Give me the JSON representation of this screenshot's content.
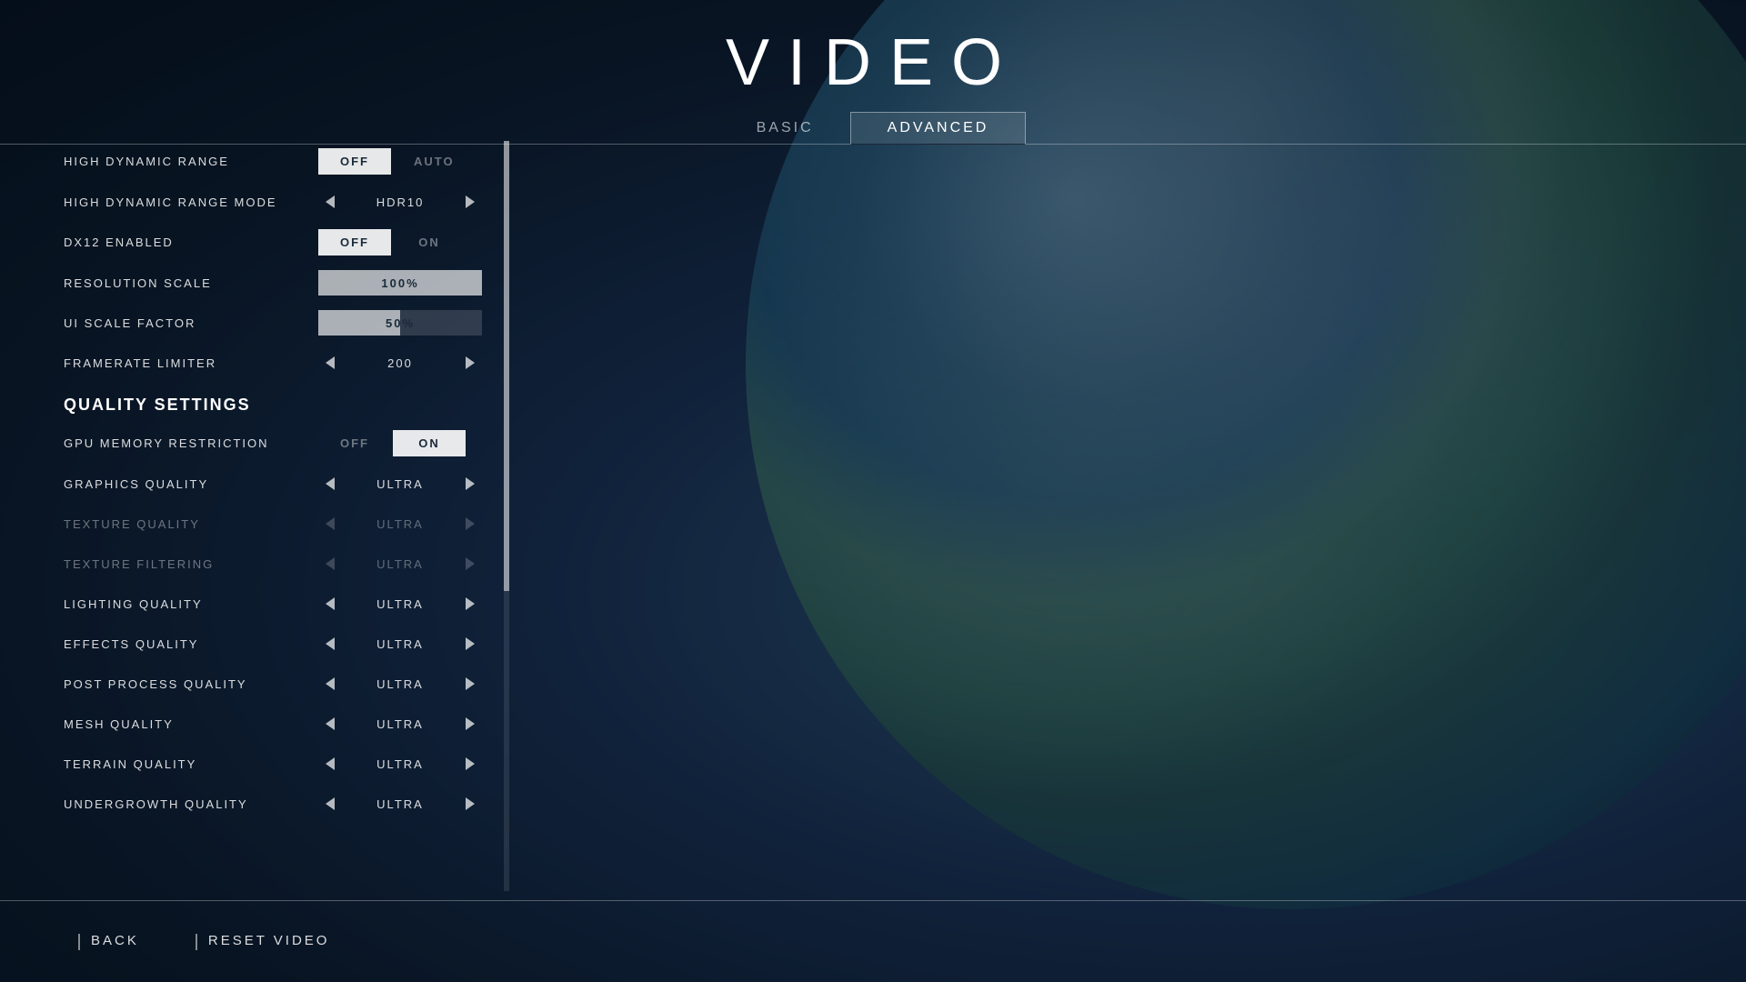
{
  "page": {
    "title": "VIDEO",
    "background_color": "#0d1a28"
  },
  "tabs": [
    {
      "id": "basic",
      "label": "BASIC",
      "active": false
    },
    {
      "id": "advanced",
      "label": "ADVANCED",
      "active": true
    }
  ],
  "settings": {
    "rows": [
      {
        "id": "high-dynamic-range",
        "label": "HIGH DYNAMIC RANGE",
        "type": "toggle",
        "options": [
          "OFF",
          "AUTO"
        ],
        "selected": "OFF"
      },
      {
        "id": "high-dynamic-range-mode",
        "label": "HIGH DYNAMIC RANGE MODE",
        "type": "arrow-select",
        "value": "HDR10",
        "dim": false
      },
      {
        "id": "dx12-enabled",
        "label": "DX12 ENABLED",
        "type": "toggle",
        "options": [
          "OFF",
          "ON"
        ],
        "selected": "OFF"
      },
      {
        "id": "resolution-scale",
        "label": "RESOLUTION SCALE",
        "type": "slider",
        "value": "100%",
        "percent": 100
      },
      {
        "id": "ui-scale-factor",
        "label": "UI SCALE FACTOR",
        "type": "slider",
        "value": "50%",
        "percent": 50
      },
      {
        "id": "framerate-limiter",
        "label": "FRAMERATE LIMITER",
        "type": "arrow-select",
        "value": "200",
        "dim": false
      }
    ],
    "section_header": {
      "id": "quality-settings",
      "label": "QUALITY SETTINGS"
    },
    "quality_rows": [
      {
        "id": "gpu-memory-restriction",
        "label": "GPU MEMORY RESTRICTION",
        "type": "toggle",
        "options": [
          "OFF",
          "ON"
        ],
        "selected": "ON"
      },
      {
        "id": "graphics-quality",
        "label": "GRAPHICS QUALITY",
        "type": "arrow-select",
        "value": "ULTRA",
        "dim": false
      },
      {
        "id": "texture-quality",
        "label": "TEXTURE QUALITY",
        "type": "arrow-select",
        "value": "ULTRA",
        "dim": true
      },
      {
        "id": "texture-filtering",
        "label": "TEXTURE FILTERING",
        "type": "arrow-select",
        "value": "ULTRA",
        "dim": true
      },
      {
        "id": "lighting-quality",
        "label": "LIGHTING QUALITY",
        "type": "arrow-select",
        "value": "ULTRA",
        "dim": false
      },
      {
        "id": "effects-quality",
        "label": "EFFECTS QUALITY",
        "type": "arrow-select",
        "value": "ULTRA",
        "dim": false
      },
      {
        "id": "post-process-quality",
        "label": "POST PROCESS QUALITY",
        "type": "arrow-select",
        "value": "ULTRA",
        "dim": false
      },
      {
        "id": "mesh-quality",
        "label": "MESH QUALITY",
        "type": "arrow-select",
        "value": "ULTRA",
        "dim": false
      },
      {
        "id": "terrain-quality",
        "label": "TERRAIN QUALITY",
        "type": "arrow-select",
        "value": "ULTRA",
        "dim": false
      },
      {
        "id": "undergrowth-quality",
        "label": "UNDERGROWTH QUALITY",
        "type": "arrow-select",
        "value": "ULTRA",
        "dim": false
      }
    ]
  },
  "bottom_buttons": [
    {
      "id": "back",
      "label": "BACK"
    },
    {
      "id": "reset-video",
      "label": "RESET VIDEO"
    }
  ]
}
